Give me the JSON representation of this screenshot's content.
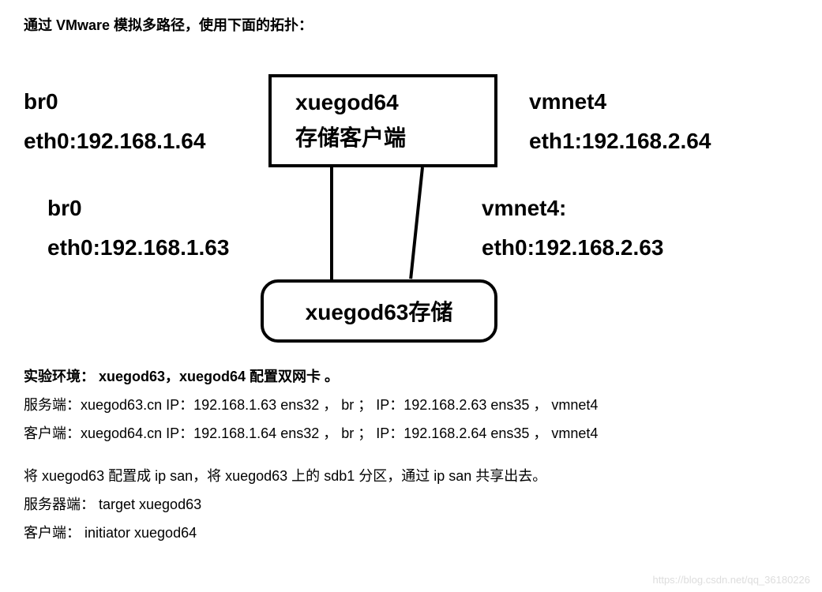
{
  "title": "通过 VMware 模拟多路径，使用下面的拓扑：",
  "diagram": {
    "topBox": {
      "line1": "xuegod64",
      "line2": "存储客户端"
    },
    "bottomBox": {
      "label": "xuegod63存储"
    },
    "topLeft": {
      "l1": "br0",
      "l2": "eth0:192.168.1.64"
    },
    "topRight": {
      "l1": "vmnet4",
      "l2": "eth1:192.168.2.64"
    },
    "midLeft": {
      "l1": "br0",
      "l2": "eth0:192.168.1.63"
    },
    "midRight": {
      "l1": "vmnet4:",
      "l2": "eth0:192.168.2.63"
    }
  },
  "info": {
    "envTitle": "实验环境：    xuegod63，xuegod64 配置双网卡  。",
    "server": "服务端：xuegod63.cn      IP：192.168.1.63 ens32  ， br    ；   IP：192.168.2.63 ens35  ，   vmnet4",
    "client": "客户端：xuegod64.cn      IP：192.168.1.64 ens32  ， br    ；   IP：192.168.2.64 ens35  ，   vmnet4",
    "desc": "将 xuegod63 配置成 ip san，将 xuegod63 上的 sdb1 分区，通过 ip san  共享出去。",
    "serverRole": "服务器端：   target         xuegod63",
    "clientRole": "客户端：      initiator        xuegod64"
  },
  "watermark": "https://blog.csdn.net/qq_36180226"
}
